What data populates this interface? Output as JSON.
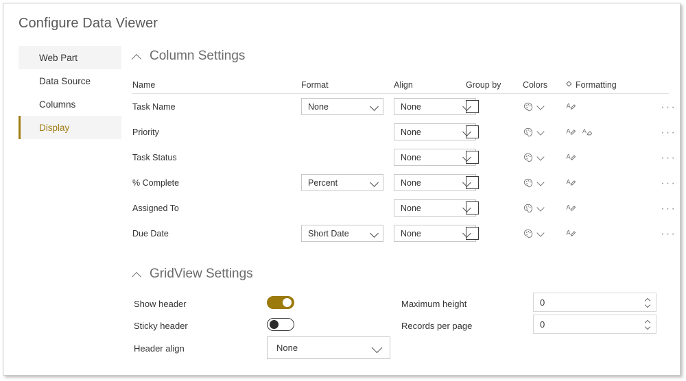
{
  "window": {
    "title": "Configure Data Viewer"
  },
  "sidebar": {
    "items": [
      {
        "label": "Web Part",
        "selected": false,
        "shaded": true
      },
      {
        "label": "Data Source",
        "selected": false,
        "shaded": false
      },
      {
        "label": "Columns",
        "selected": false,
        "shaded": false
      },
      {
        "label": "Display",
        "selected": true,
        "shaded": true
      }
    ]
  },
  "column_settings": {
    "section_title": "Column Settings",
    "collapsed": false,
    "headers": {
      "name": "Name",
      "format": "Format",
      "align": "Align",
      "group_by": "Group by",
      "colors": "Colors",
      "formatting": "Formatting"
    },
    "rows": [
      {
        "name": "Task Name",
        "format": "None",
        "has_format": true,
        "align": "None",
        "group_by": false,
        "formatting_icons": 1
      },
      {
        "name": "Priority",
        "format": "",
        "has_format": false,
        "align": "None",
        "group_by": false,
        "formatting_icons": 2
      },
      {
        "name": "Task Status",
        "format": "",
        "has_format": false,
        "align": "None",
        "group_by": false,
        "formatting_icons": 1
      },
      {
        "name": "% Complete",
        "format": "Percent",
        "has_format": true,
        "align": "None",
        "group_by": false,
        "formatting_icons": 1
      },
      {
        "name": "Assigned To",
        "format": "",
        "has_format": false,
        "align": "None",
        "group_by": false,
        "formatting_icons": 1
      },
      {
        "name": "Due Date",
        "format": "Short Date",
        "has_format": true,
        "align": "None",
        "group_by": false,
        "formatting_icons": 1
      }
    ],
    "row_menu_label": "···"
  },
  "gridview_settings": {
    "section_title": "GridView Settings",
    "collapsed": false,
    "show_header": {
      "label": "Show header",
      "value": true
    },
    "sticky_header": {
      "label": "Sticky header",
      "value": false
    },
    "header_align": {
      "label": "Header align",
      "value": "None"
    },
    "maximum_height": {
      "label": "Maximum height",
      "value": "0"
    },
    "records_per_page": {
      "label": "Records per page",
      "value": "0"
    }
  },
  "colors": {
    "accent": "#9c7a0c",
    "selected_text": "#a07d14",
    "title_text": "#595959",
    "body_text": "#333333",
    "icon_grey": "#6b6b6b",
    "border_grey": "#c7c7c7"
  }
}
